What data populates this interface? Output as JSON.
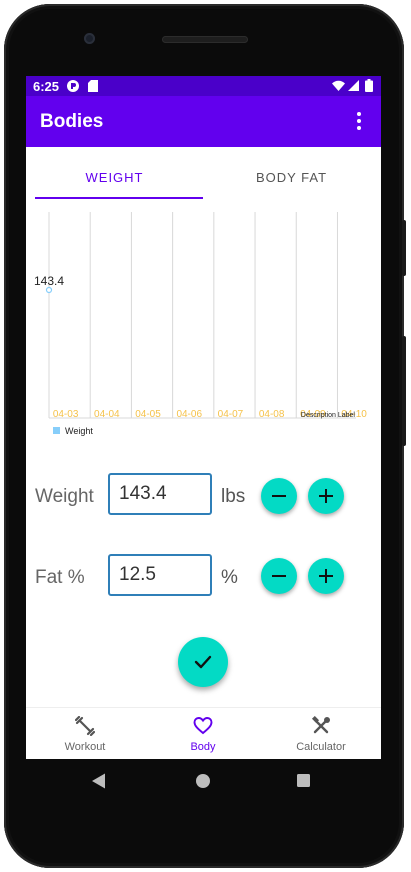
{
  "status_bar": {
    "time": "6:25"
  },
  "app_bar": {
    "title": "Bodies",
    "more_icon": "more-vert-icon"
  },
  "tabs": [
    {
      "label": "WEIGHT",
      "active": true
    },
    {
      "label": "BODY FAT",
      "active": false
    }
  ],
  "chart_data": {
    "type": "line",
    "x": [
      "04-03",
      "04-04",
      "04-05",
      "04-06",
      "04-07",
      "04-08",
      "04-09",
      "04-10"
    ],
    "series": [
      {
        "name": "Weight",
        "values": [
          143.4
        ]
      }
    ],
    "point_label": "143.4",
    "legend": "Weight",
    "description": "Description Label",
    "grid": true,
    "colors": {
      "series": "#87cefa",
      "tick": "#f5c24a",
      "grid": "#d8d8d8"
    }
  },
  "form": {
    "weight": {
      "label": "Weight",
      "value": "143.4",
      "unit": "lbs"
    },
    "fat": {
      "label": "Fat %",
      "value": "12.5",
      "unit": "%"
    }
  },
  "bottom_nav": [
    {
      "label": "Workout",
      "icon": "dumbbell-icon",
      "active": false
    },
    {
      "label": "Body",
      "icon": "heart-icon",
      "active": true
    },
    {
      "label": "Calculator",
      "icon": "tools-icon",
      "active": false
    }
  ],
  "colors": {
    "primary": "#6200ee",
    "status": "#4a00c9",
    "accent": "#03dac5",
    "field_border": "#2f7fb8"
  }
}
